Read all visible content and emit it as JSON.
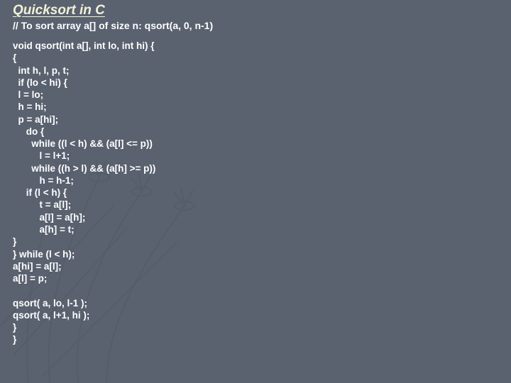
{
  "slide": {
    "title": "Quicksort in C",
    "comment": "// To sort array a[] of size n: qsort(a, 0, n-1)",
    "code": "void qsort(int a[], int lo, int hi) {\n{\n  int h, l, p, t;\n  if (lo < hi) {\n  l = lo;\n  h = hi;\n  p = a[hi];\n     do {\n       while ((l < h) && (a[l] <= p))\n          l = l+1;\n       while ((h > l) && (a[h] >= p))\n          h = h-1;\n     if (l < h) {\n          t = a[l];\n          a[l] = a[h];\n          a[h] = t;\n}\n} while (l < h);\na[hi] = a[l];\na[l] = p;\n\nqsort( a, lo, l-1 );\nqsort( a, l+1, hi );\n}\n}"
  }
}
